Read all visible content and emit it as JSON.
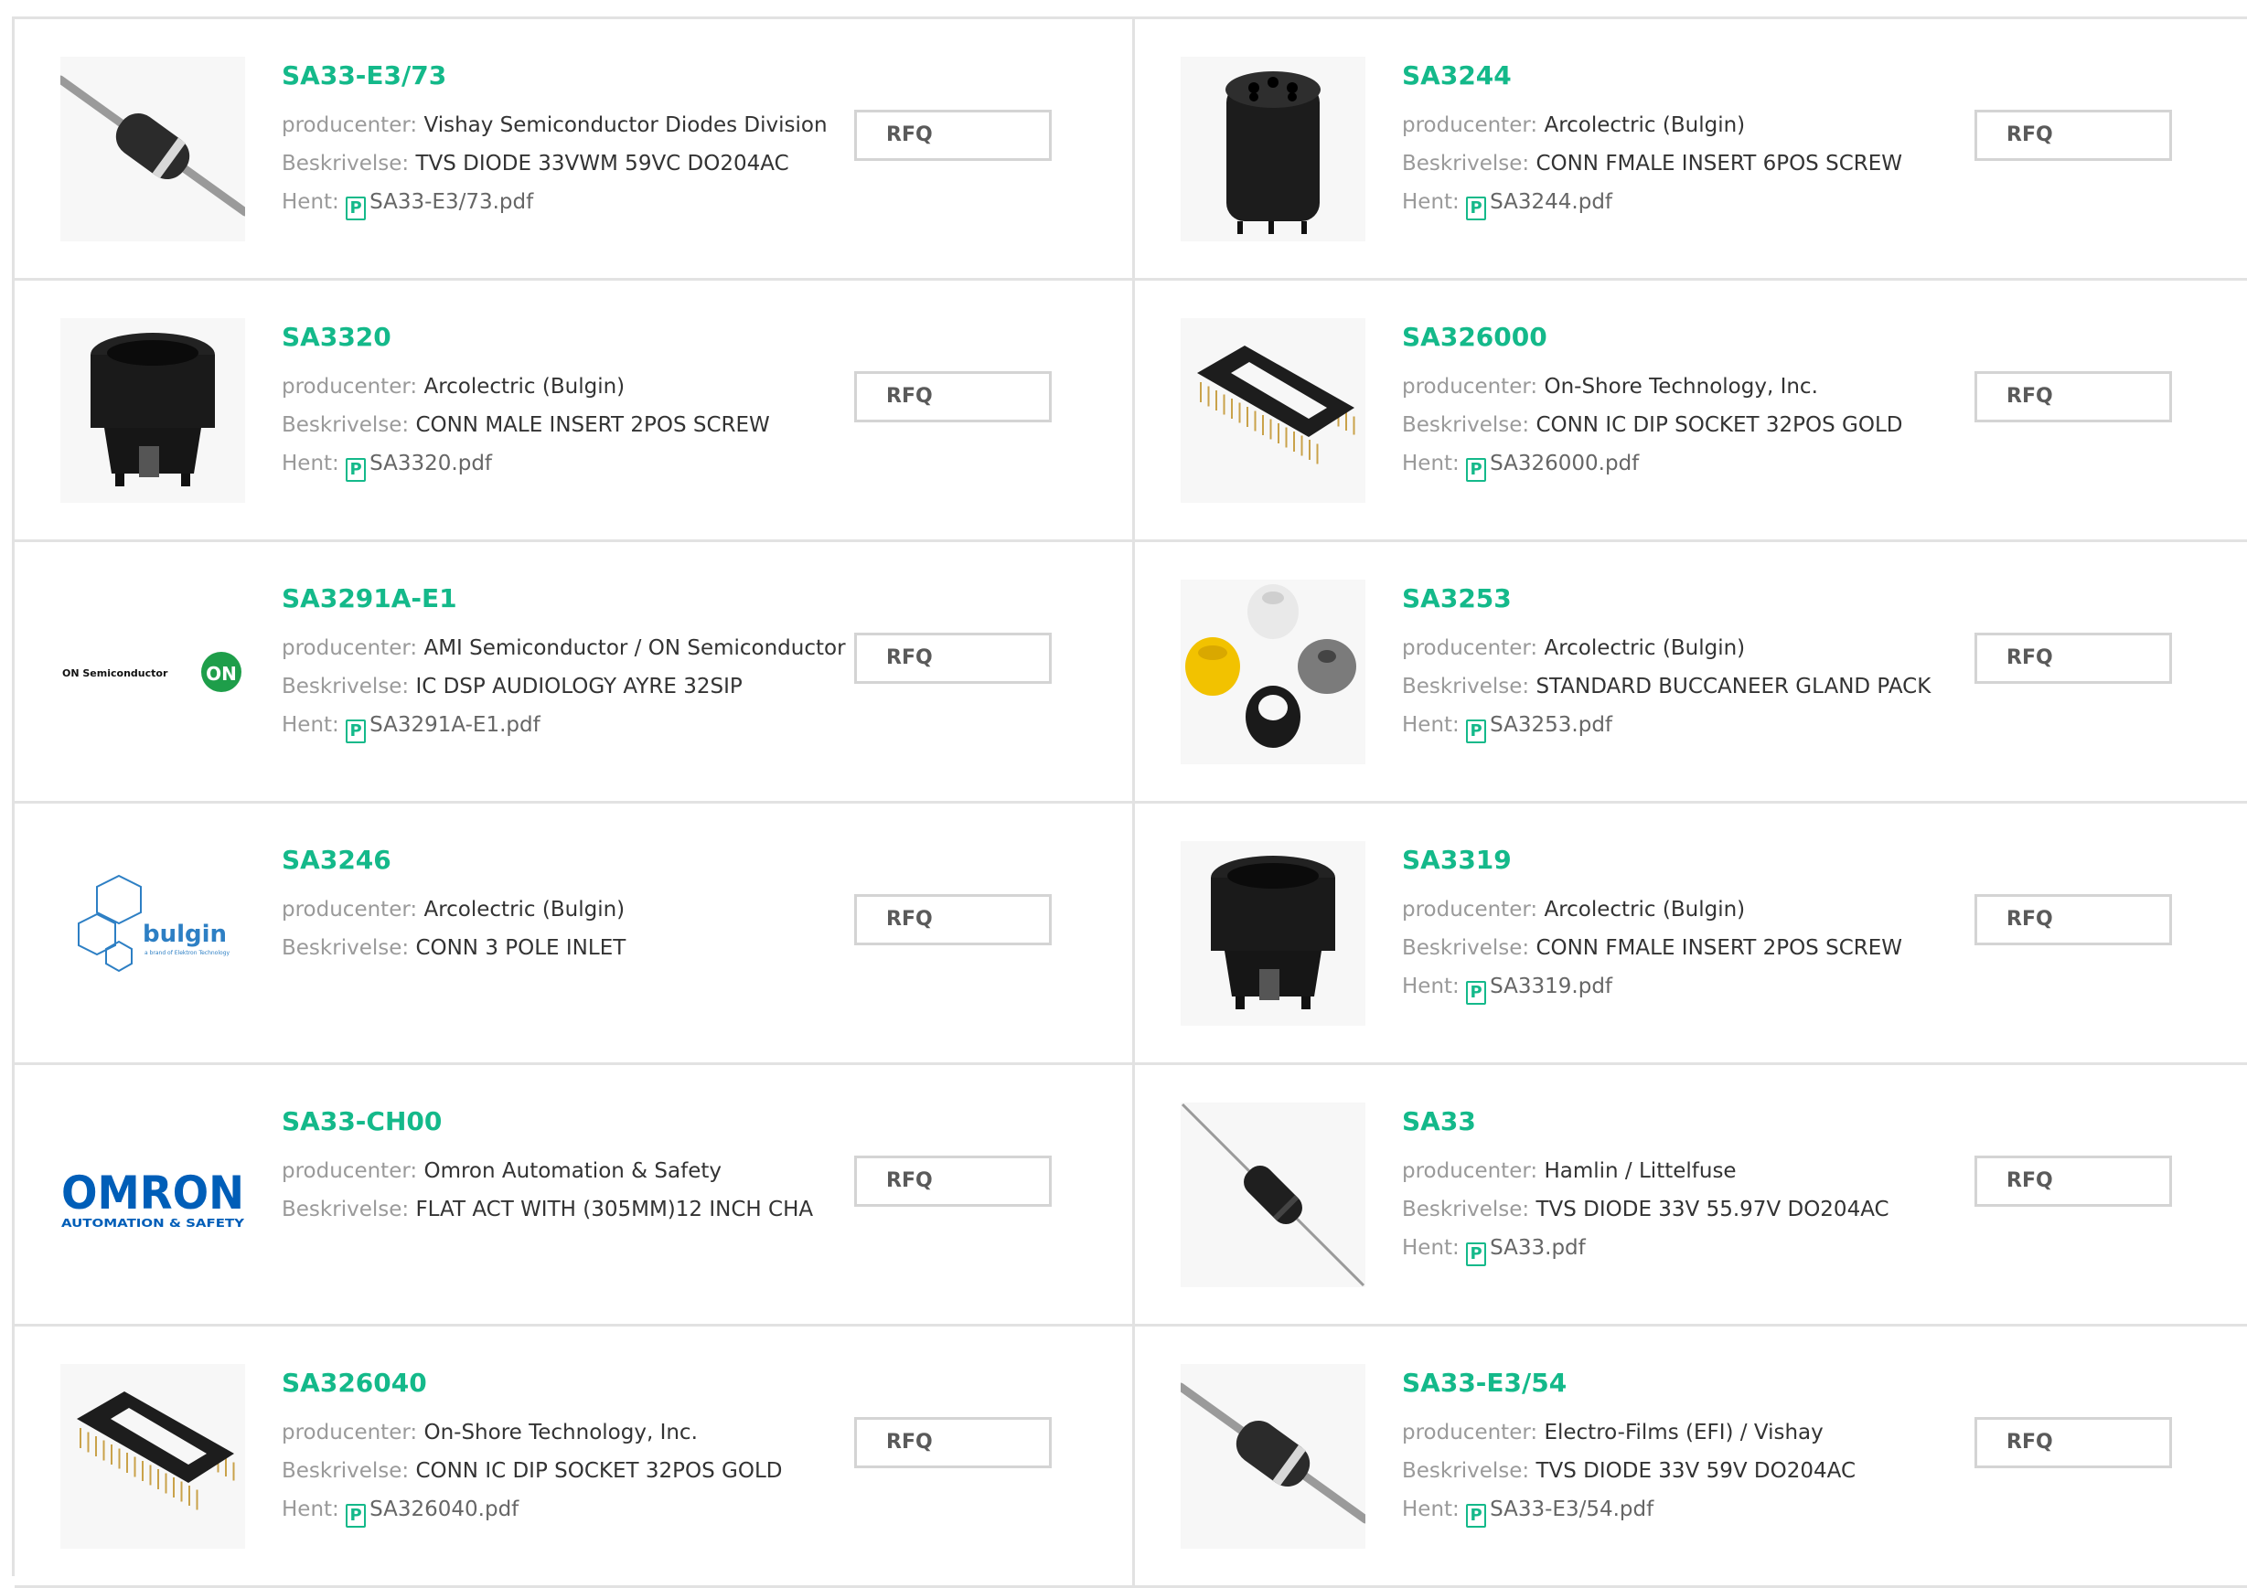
{
  "labels": {
    "producer": "producenter:",
    "description": "Beskrivelse:",
    "download": "Hent:",
    "rfq": "RFQ"
  },
  "products": [
    {
      "part": "SA33-E3/73",
      "producer": "Vishay Semiconductor Diodes Division",
      "description": "TVS DIODE 33VWM 59VC DO204AC",
      "pdf": "SA33-E3/73.pdf",
      "image": "diode-grey"
    },
    {
      "part": "SA3244",
      "producer": "Arcolectric (Bulgin)",
      "description": "CONN FMALE INSERT 6POS SCREW",
      "pdf": "SA3244.pdf",
      "image": "connector-insert-6pos"
    },
    {
      "part": "SA3320",
      "producer": "Arcolectric (Bulgin)",
      "description": "CONN MALE INSERT 2POS SCREW",
      "pdf": "SA3320.pdf",
      "image": "connector-insert-2pos"
    },
    {
      "part": "SA326000",
      "producer": "On-Shore Technology, Inc.",
      "description": "CONN IC DIP SOCKET 32POS GOLD",
      "pdf": "SA326000.pdf",
      "image": "dip-socket"
    },
    {
      "part": "SA3291A-E1",
      "producer": "AMI Semiconductor / ON Semiconductor",
      "description": "IC DSP AUDIOLOGY AYRE 32SIP",
      "pdf": "SA3291A-E1.pdf",
      "image": "on-semiconductor-logo",
      "logo_text": "ON Semiconductor",
      "logo_mark": "ON"
    },
    {
      "part": "SA3253",
      "producer": "Arcolectric (Bulgin)",
      "description": "STANDARD BUCCANEER GLAND PACK",
      "pdf": "SA3253.pdf",
      "image": "gland-pack"
    },
    {
      "part": "SA3246",
      "producer": "Arcolectric (Bulgin)",
      "description": "CONN 3 POLE INLET",
      "pdf": null,
      "image": "bulgin-logo",
      "logo_text": "bulgin",
      "logo_sub": "a brand of Elektron Technology"
    },
    {
      "part": "SA3319",
      "producer": "Arcolectric (Bulgin)",
      "description": "CONN FMALE INSERT 2POS SCREW",
      "pdf": "SA3319.pdf",
      "image": "connector-insert-2pos-b"
    },
    {
      "part": "SA33-CH00",
      "producer": "Omron Automation & Safety",
      "description": "FLAT ACT WITH (305MM)12 INCH CHA",
      "pdf": null,
      "image": "omron-logo",
      "logo_text": "OMRON",
      "logo_sub": "AUTOMATION & SAFETY"
    },
    {
      "part": "SA33",
      "producer": "Hamlin / Littelfuse",
      "description": "TVS DIODE 33V 55.97V DO204AC",
      "pdf": "SA33.pdf",
      "image": "diode-black"
    },
    {
      "part": "SA326040",
      "producer": "On-Shore Technology, Inc.",
      "description": "CONN IC DIP SOCKET 32POS GOLD",
      "pdf": "SA326040.pdf",
      "image": "dip-socket"
    },
    {
      "part": "SA33-E3/54",
      "producer": "Electro-Films (EFI) / Vishay",
      "description": "TVS DIODE 33V 59V DO204AC",
      "pdf": "SA33-E3/54.pdf",
      "image": "diode-grey"
    }
  ]
}
